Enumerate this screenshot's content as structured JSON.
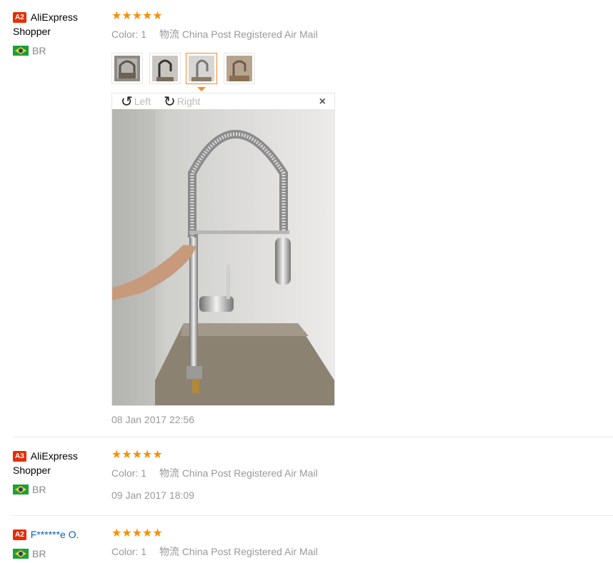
{
  "reviews": [
    {
      "level": "A2",
      "name": "AliExpress Shopper",
      "country": "BR",
      "stars": "★★★★★",
      "color_label": "Color:",
      "color_value": "1",
      "shipping": "物流 China Post Registered Air Mail",
      "date": "08 Jan 2017 22:56",
      "viewer": {
        "left": "Left",
        "right": "Right",
        "close": "×"
      }
    },
    {
      "level": "A3",
      "name": "AliExpress Shopper",
      "country": "BR",
      "stars": "★★★★★",
      "color_label": "Color:",
      "color_value": "1",
      "shipping": "物流 China Post Registered Air Mail",
      "date": "09 Jan 2017 18:09"
    },
    {
      "level": "A2",
      "name": "F******e O.",
      "country": "BR",
      "stars": "★★★★★",
      "color_label": "Color:",
      "color_value": "1",
      "shipping": "物流 China Post Registered Air Mail"
    }
  ],
  "colors": {
    "level_badge": "#e62e04",
    "stars": "#f79009",
    "active_thumb": "#f48a2c",
    "link": "#0d5fb8"
  }
}
